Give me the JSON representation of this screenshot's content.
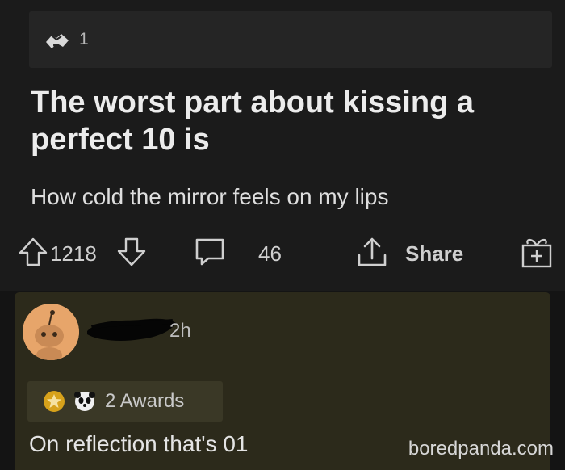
{
  "post": {
    "award_count": "1",
    "title": "The worst part about kissing a perfect 10 is",
    "body": "How cold the mirror feels on my lips",
    "actions": {
      "upvotes": "1218",
      "comments": "46",
      "share_label": "Share"
    }
  },
  "comment": {
    "time": "2h",
    "awards_label": "2 Awards",
    "text": "On reflection that's 01"
  },
  "watermark": "boredpanda.com",
  "icons": {
    "award": "handshake-award-icon",
    "upvote": "upvote-arrow-icon",
    "downvote": "downvote-arrow-icon",
    "comment": "comment-bubble-icon",
    "share": "share-icon",
    "gift": "gift-icon"
  },
  "colors": {
    "background": "#141414",
    "post_background": "#1b1b1b",
    "comment_background": "#2c2a1b",
    "avatar": "#e7a56a"
  }
}
